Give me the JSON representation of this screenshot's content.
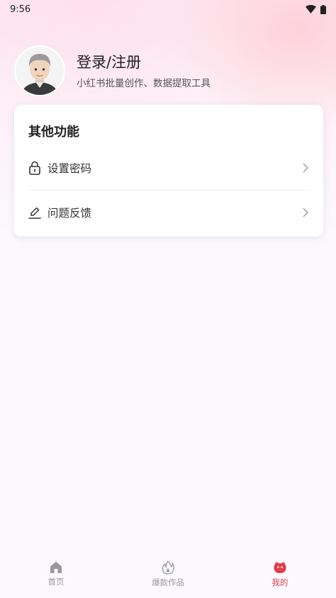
{
  "status_bar": {
    "time": "9:56"
  },
  "profile": {
    "login_label": "登录/注册",
    "subtitle": "小红书批量创作、数据提取工具"
  },
  "functions": {
    "title": "其他功能",
    "items": [
      {
        "label": "设置密码",
        "icon": "lock-icon"
      },
      {
        "label": "问题反馈",
        "icon": "edit-icon"
      }
    ]
  },
  "bottom_nav": {
    "items": [
      {
        "label": "首页",
        "icon": "home-icon",
        "active": false
      },
      {
        "label": "爆款作品",
        "icon": "fire-icon",
        "active": false
      },
      {
        "label": "我的",
        "icon": "mine-icon",
        "active": true
      }
    ]
  },
  "colors": {
    "accent": "#e23d4c",
    "inactive": "#999999",
    "background": "#fbf9fd"
  }
}
